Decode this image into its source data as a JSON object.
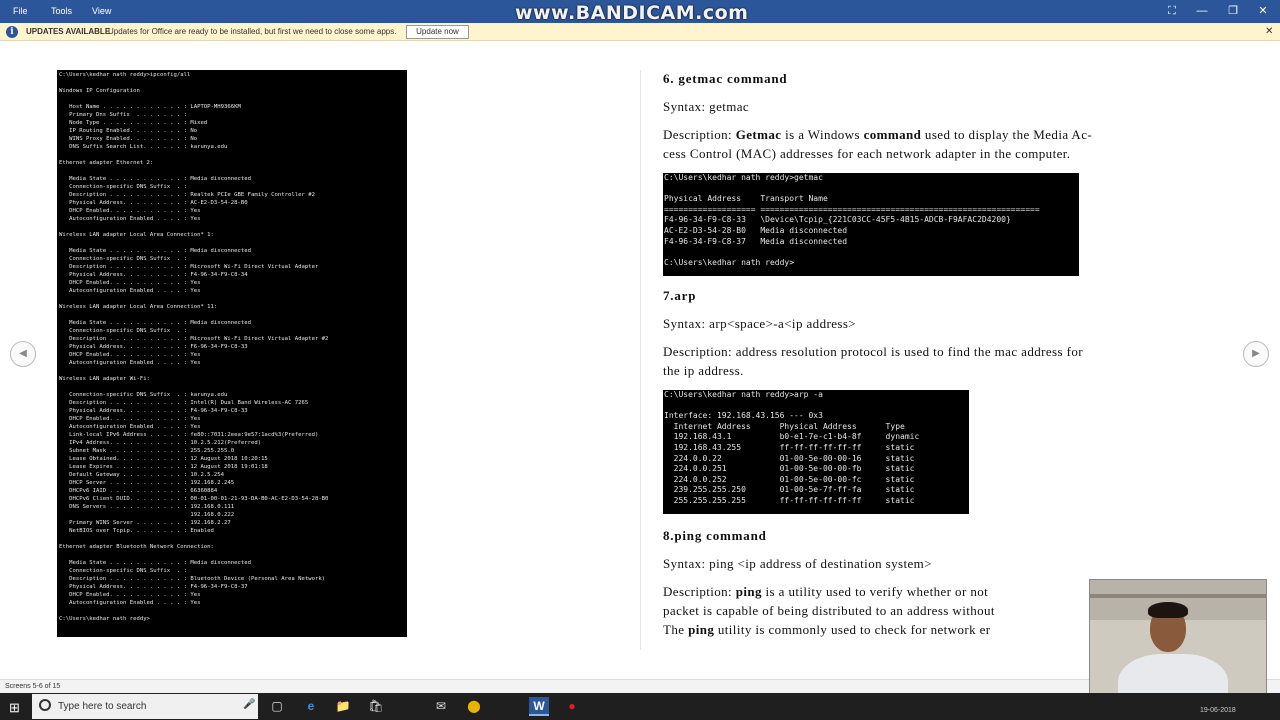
{
  "menu": {
    "file": "File",
    "tools": "Tools",
    "view": "View"
  },
  "watermark": "www.BANDICAM.com",
  "window": {
    "fullscreen_icon": "⛶",
    "minimize": "—",
    "restore": "❐",
    "close": "✕"
  },
  "update_bar": {
    "icon": "i",
    "title": "UPDATES AVAILABLE",
    "message": "Updates for Office are ready to be installed, but first we need to close some apps.",
    "button": "Update now",
    "close": "✕"
  },
  "terminal_ipconfig": {
    "lines": [
      "C:\\Users\\kedhar nath reddy>ipconfig/all",
      "",
      "Windows IP Configuration",
      "",
      "   Host Name . . . . . . . . . . . . : LAPTOP-MH9366KM",
      "   Primary Dns Suffix  . . . . . . . :",
      "   Node Type . . . . . . . . . . . . : Mixed",
      "   IP Routing Enabled. . . . . . . . : No",
      "   WINS Proxy Enabled. . . . . . . . : No",
      "   DNS Suffix Search List. . . . . . : karunya.edu",
      "",
      "Ethernet adapter Ethernet 2:",
      "",
      "   Media State . . . . . . . . . . . : Media disconnected",
      "   Connection-specific DNS Suffix  . :",
      "   Description . . . . . . . . . . . : Realtek PCIe GBE Family Controller #2",
      "   Physical Address. . . . . . . . . : AC-E2-D3-54-28-B0",
      "   DHCP Enabled. . . . . . . . . . . : Yes",
      "   Autoconfiguration Enabled . . . . : Yes",
      "",
      "Wireless LAN adapter Local Area Connection* 1:",
      "",
      "   Media State . . . . . . . . . . . : Media disconnected",
      "   Connection-specific DNS Suffix  . :",
      "   Description . . . . . . . . . . . : Microsoft Wi-Fi Direct Virtual Adapter",
      "   Physical Address. . . . . . . . . : F4-96-34-F9-C8-34",
      "   DHCP Enabled. . . . . . . . . . . : Yes",
      "   Autoconfiguration Enabled . . . . : Yes",
      "",
      "Wireless LAN adapter Local Area Connection* 11:",
      "",
      "   Media State . . . . . . . . . . . : Media disconnected",
      "   Connection-specific DNS Suffix  . :",
      "   Description . . . . . . . . . . . : Microsoft Wi-Fi Direct Virtual Adapter #2",
      "   Physical Address. . . . . . . . . : F6-96-34-F9-C8-33",
      "   DHCP Enabled. . . . . . . . . . . : Yes",
      "   Autoconfiguration Enabled . . . . : Yes",
      "",
      "Wireless LAN adapter Wi-Fi:",
      "",
      "   Connection-specific DNS Suffix  . : karunya.edu",
      "   Description . . . . . . . . . . . : Intel(R) Dual Band Wireless-AC 7265",
      "   Physical Address. . . . . . . . . : F4-96-34-F9-C8-33",
      "   DHCP Enabled. . . . . . . . . . . : Yes",
      "   Autoconfiguration Enabled . . . . : Yes",
      "   Link-local IPv6 Address . . . . . : fe80::7031:2eea:9e57:1acd%3(Preferred)",
      "   IPv4 Address. . . . . . . . . . . : 10.2.5.212(Preferred)",
      "   Subnet Mask . . . . . . . . . . . : 255.255.255.0",
      "   Lease Obtained. . . . . . . . . . : 12 August 2018 10:20:15",
      "   Lease Expires . . . . . . . . . . : 12 August 2018 19:01:18",
      "   Default Gateway . . . . . . . . . : 10.2.5.254",
      "   DHCP Server . . . . . . . . . . . : 192.168.2.245",
      "   DHCPv6 IAID . . . . . . . . . . . : 66360884",
      "   DHCPv6 Client DUID. . . . . . . . : 00-01-00-01-21-93-DA-B0-AC-E2-D3-54-28-B0",
      "   DNS Servers . . . . . . . . . . . : 192.168.0.111",
      "                                       192.168.0.222",
      "   Primary WINS Server . . . . . . . : 192.168.2.27",
      "   NetBIOS over Tcpip. . . . . . . . : Enabled",
      "",
      "Ethernet adapter Bluetooth Network Connection:",
      "",
      "   Media State . . . . . . . . . . . : Media disconnected",
      "   Connection-specific DNS Suffix  . :",
      "   Description . . . . . . . . . . . : Bluetooth Device (Personal Area Network)",
      "   Physical Address. . . . . . . . . : F4-96-34-F9-C8-37",
      "   DHCP Enabled. . . . . . . . . . . : Yes",
      "   Autoconfiguration Enabled . . . . : Yes",
      "",
      "C:\\Users\\kedhar nath reddy>"
    ]
  },
  "section6": {
    "heading": "6. getmac command",
    "syntax": "Syntax: getmac",
    "desc_line1_parts": [
      "Description: ",
      "Getmac",
      " is a Windows ",
      "command",
      " used to display the Media Ac-"
    ],
    "desc_line2": "cess Control (MAC) addresses for each network adapter in the computer."
  },
  "terminal_getmac": {
    "lines": [
      "C:\\Users\\kedhar nath reddy>getmac",
      "",
      "Physical Address    Transport Name",
      "=================== ==========================================================",
      "F4-96-34-F9-C8-33   \\Device\\Tcpip_{221C03CC-45F5-4B15-ADCB-F9AFAC2D4200}",
      "AC-E2-D3-54-28-B0   Media disconnected",
      "F4-96-34-F9-C8-37   Media disconnected",
      "",
      "C:\\Users\\kedhar nath reddy>"
    ]
  },
  "section7": {
    "heading": "7.arp",
    "syntax": "Syntax: arp<space>-a<ip address>",
    "desc_line1": "Description: address resolution protocol is used to find the mac address for",
    "desc_line2": "the ip address."
  },
  "terminal_arp": {
    "lines": [
      "C:\\Users\\kedhar nath reddy>arp -a",
      "",
      "Interface: 192.168.43.156 --- 0x3",
      "  Internet Address      Physical Address      Type",
      "  192.168.43.1          b0-e1-7e-c1-b4-8f     dynamic",
      "  192.168.43.255        ff-ff-ff-ff-ff-ff     static",
      "  224.0.0.22            01-00-5e-00-00-16     static",
      "  224.0.0.251           01-00-5e-00-00-fb     static",
      "  224.0.0.252           01-00-5e-00-00-fc     static",
      "  239.255.255.250       01-00-5e-7f-ff-fa     static",
      "  255.255.255.255       ff-ff-ff-ff-ff-ff     static"
    ]
  },
  "section8": {
    "heading": "8.ping command",
    "syntax": "Syntax: ping <ip address of destination system>",
    "desc_line1_parts": [
      "Description: ",
      "ping",
      " is a utility used to verify whether or not"
    ],
    "desc_line2": "packet is capable of being distributed to an address without",
    "desc_line3_parts": [
      "The ",
      "ping",
      " utility is commonly used to check for network er"
    ]
  },
  "nav": {
    "prev": "◀",
    "next": "▶"
  },
  "status": {
    "screens": "Screens 5-6 of 15"
  },
  "taskbar": {
    "search_placeholder": "Type here to search",
    "start_icon": "⊞",
    "mic_icon": "🎤",
    "apps": [
      "▢",
      "e",
      "📁",
      "🛍",
      "✉",
      "⬤",
      "W",
      "●"
    ],
    "clock": "19-06-2018"
  }
}
